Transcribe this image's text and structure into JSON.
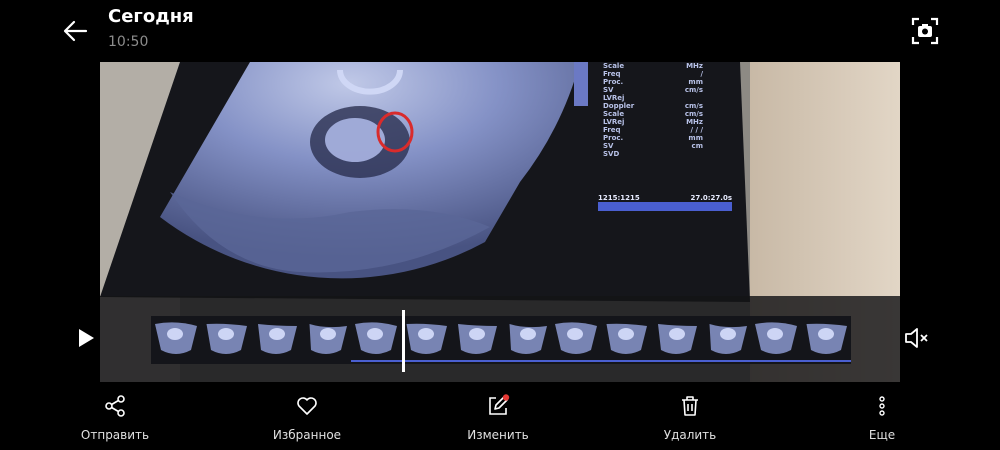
{
  "header": {
    "title": "Сегодня",
    "time": "10:50"
  },
  "ultrasound_text": {
    "rows": [
      {
        "k": "Scale",
        "v": "MHz"
      },
      {
        "k": "Freq",
        "v": "/"
      },
      {
        "k": "Proc.",
        "v": "mm"
      },
      {
        "k": "SV",
        "v": "cm/s"
      },
      {
        "k": "LVRej",
        "v": ""
      },
      {
        "k": "Doppler",
        "v": "cm/s"
      },
      {
        "k": "Scale",
        "v": "cm/s"
      },
      {
        "k": "LVRej",
        "v": "MHz"
      },
      {
        "k": "Freq",
        "v": "/ / /"
      },
      {
        "k": "Proc.",
        "v": "mm"
      },
      {
        "k": "SV",
        "v": "cm"
      },
      {
        "k": "SVD",
        "v": ""
      }
    ],
    "bar_left": "1215:1215",
    "bar_right": "27.0:27.0s"
  },
  "video": {
    "frame_count": 14,
    "playhead_fraction": 0.36
  },
  "actions": [
    {
      "label": "Отправить",
      "icon": "share-icon"
    },
    {
      "label": "Избранное",
      "icon": "heart-icon"
    },
    {
      "label": "Изменить",
      "icon": "edit-icon"
    },
    {
      "label": "Удалить",
      "icon": "trash-icon"
    },
    {
      "label": "Еще",
      "icon": "more-vertical-icon"
    }
  ],
  "colors": {
    "accent_dot": "#e53935",
    "ultrasound_tint": "#9fb0e8",
    "circle_marker": "#d92b2b"
  }
}
